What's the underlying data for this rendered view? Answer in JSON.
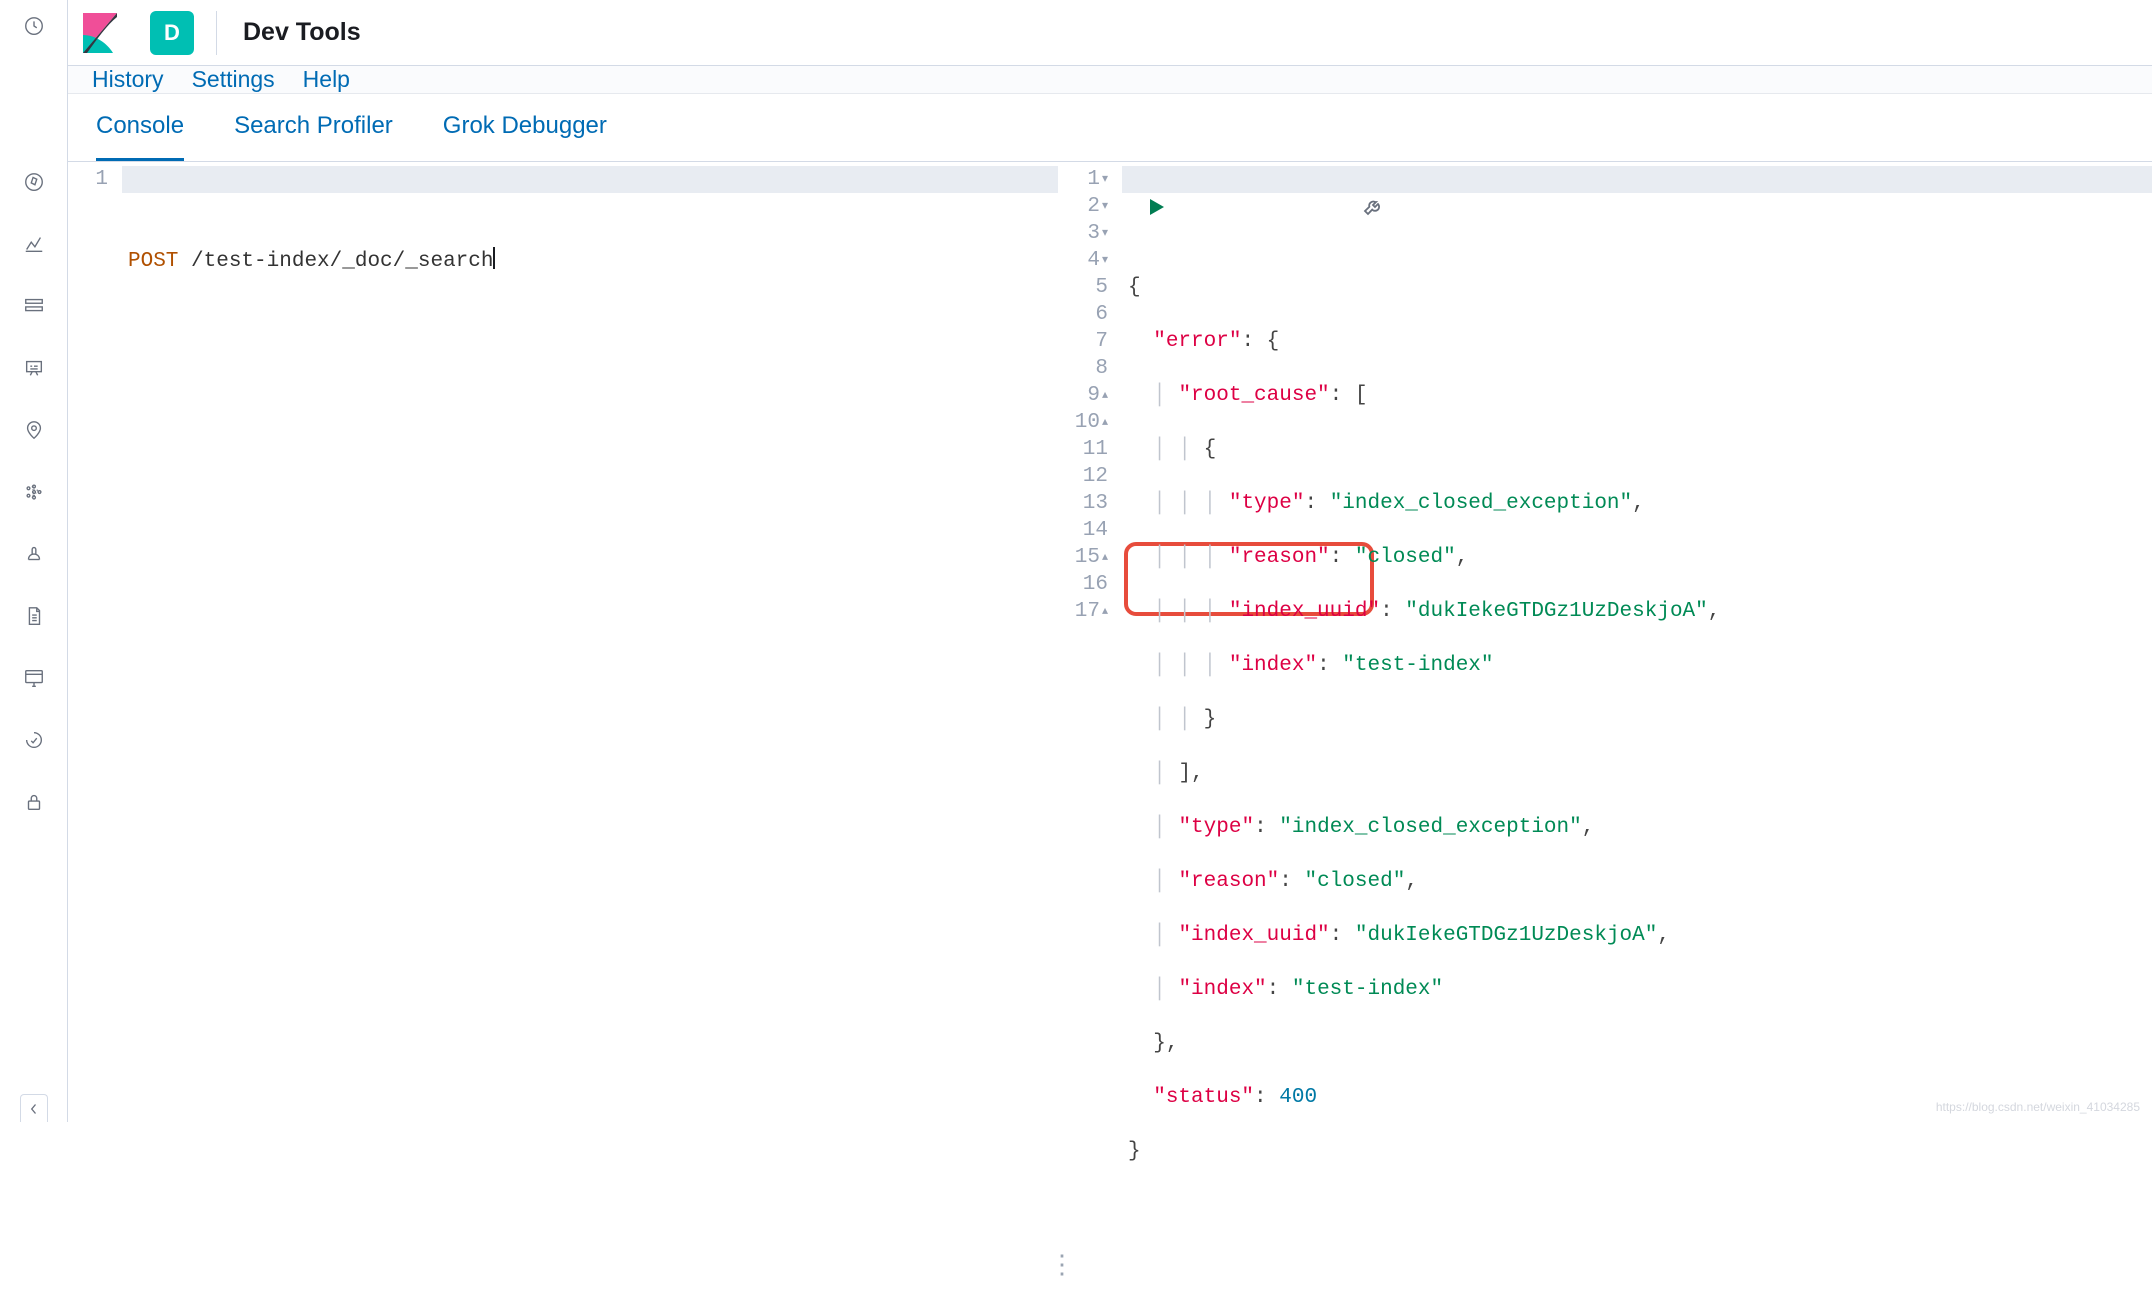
{
  "header": {
    "app_badge": "D",
    "title": "Dev Tools"
  },
  "menubar": {
    "history": "History",
    "settings": "Settings",
    "help": "Help"
  },
  "tabs": {
    "console": "Console",
    "profiler": "Search Profiler",
    "grok": "Grok Debugger",
    "active": "console"
  },
  "request": {
    "line_numbers": [
      "1"
    ],
    "method": "POST",
    "path": " /test-index/_doc/_search"
  },
  "response": {
    "line_numbers": [
      "1",
      "2",
      "3",
      "4",
      "5",
      "6",
      "7",
      "8",
      "9",
      "10",
      "11",
      "12",
      "13",
      "14",
      "15",
      "16",
      "17"
    ],
    "folds": [
      "▾",
      "▾",
      "▾",
      "▾",
      "",
      "",
      "",
      "",
      "▴",
      "▴",
      "",
      "",
      "",
      "",
      "▴",
      "",
      "▴"
    ],
    "tokens": {
      "brace_open": "{",
      "brace_close": "}",
      "bracket_open": "[",
      "bracket_close": "]",
      "comma": ",",
      "colon": ":",
      "error_key": "\"error\"",
      "root_cause_key": "\"root_cause\"",
      "type_key": "\"type\"",
      "reason_key": "\"reason\"",
      "index_uuid_key": "\"index_uuid\"",
      "index_key": "\"index\"",
      "status_key": "\"status\"",
      "type_val": "\"index_closed_exception\"",
      "reason_val": "\"closed\"",
      "uuid_val": "\"dukIekeGTDGz1UzDeskjoA\"",
      "index_val": "\"test-index\"",
      "status_val": "400"
    }
  },
  "watermark": "https://blog.csdn.net/weixin_41034285"
}
